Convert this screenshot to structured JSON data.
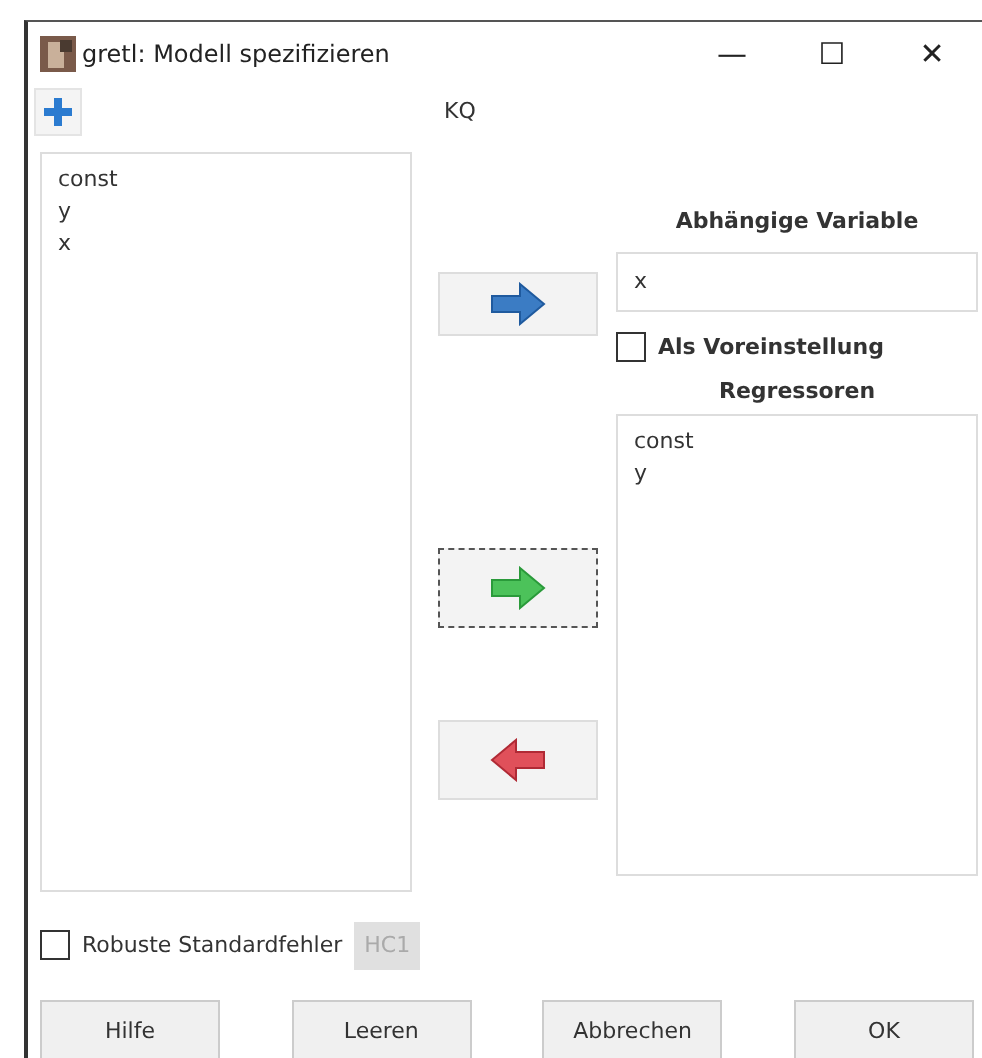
{
  "window": {
    "title": "gretl: Modell spezifizieren",
    "controls": [
      "—",
      "☐",
      "✕"
    ]
  },
  "estimator": "KQ",
  "variables": [
    "const",
    "y",
    "x"
  ],
  "arrow_buttons": [
    {
      "kind": "blue",
      "focused": false
    },
    {
      "kind": "green",
      "focused": true
    },
    {
      "kind": "red",
      "focused": false
    }
  ],
  "dependent": {
    "heading": "Abhängige Variable",
    "value": "x",
    "default_checkbox": {
      "label": "Als Voreinstellung",
      "checked": false
    }
  },
  "regressors": {
    "heading": "Regressoren",
    "items": [
      "const",
      "y"
    ]
  },
  "robust": {
    "label": "Robuste Standardfehler",
    "checked": false,
    "option": {
      "label": "HC1",
      "disabled": true
    }
  },
  "buttons": [
    "Hilfe",
    "Leeren",
    "Abbrechen",
    "OK"
  ]
}
